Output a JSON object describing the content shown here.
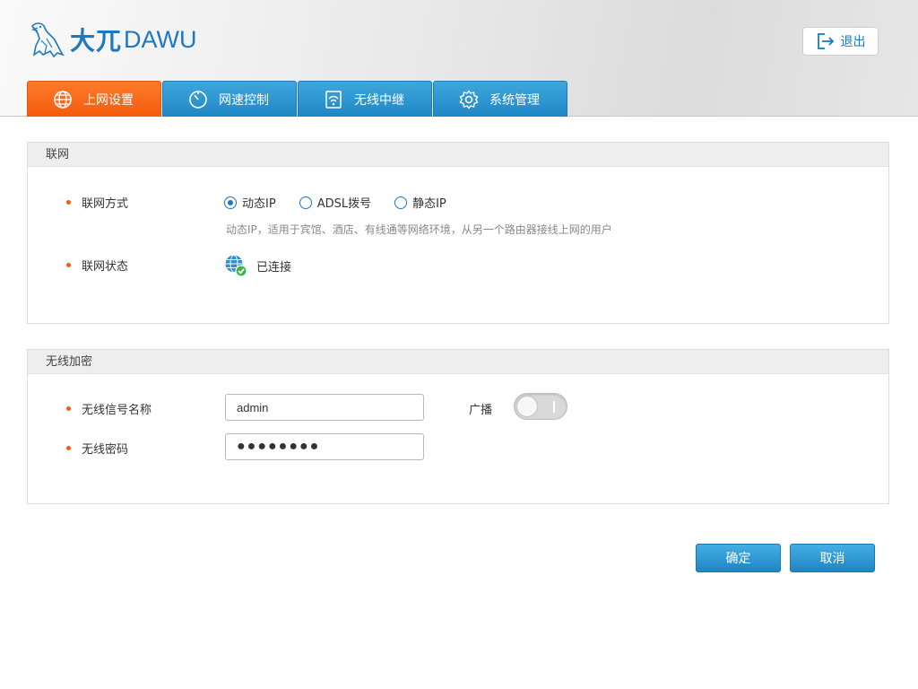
{
  "header": {
    "logo_cn": "大兀",
    "logo_en": "DAWU",
    "logout_label": "退出",
    "logout_icon": "logout-icon"
  },
  "tabs": [
    {
      "label": "上网设置",
      "icon": "globe-icon",
      "active": true
    },
    {
      "label": "网速控制",
      "icon": "speedometer-icon",
      "active": false
    },
    {
      "label": "无线中继",
      "icon": "wifi-relay-icon",
      "active": false
    },
    {
      "label": "系统管理",
      "icon": "gear-icon",
      "active": false
    }
  ],
  "network": {
    "title": "联网",
    "mode_label": "联网方式",
    "modes": [
      "动态IP",
      "ADSL拨号",
      "静态IP"
    ],
    "selected_mode": "动态IP",
    "mode_desc": "动态IP，适用于宾馆、酒店、有线通等网络环境，从另一个路由器接线上网的用户",
    "status_label": "联网状态",
    "status_value": "已连接"
  },
  "wireless": {
    "title": "无线加密",
    "ssid_label": "无线信号名称",
    "ssid_value": "admin",
    "broadcast_label": "广播",
    "broadcast_on": false,
    "password_label": "无线密码",
    "password_value": "●●●●●●●●"
  },
  "actions": {
    "confirm_label": "确定",
    "cancel_label": "取消"
  },
  "colors": {
    "accent": "#1d78c0",
    "active_tab": "#f25c0c",
    "tab": "#2a93d0"
  }
}
